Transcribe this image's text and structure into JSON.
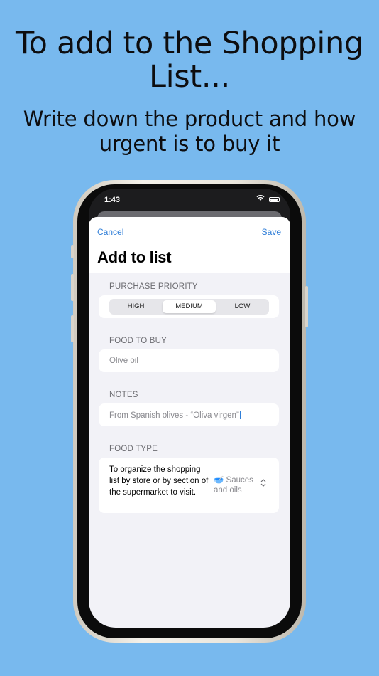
{
  "headline": {
    "title": "To add to the Shopping List...",
    "subtitle": "Write down the product and how urgent is to buy it"
  },
  "status_bar": {
    "time": "1:43"
  },
  "sheet": {
    "cancel_label": "Cancel",
    "save_label": "Save",
    "title": "Add to list",
    "priority": {
      "label": "PURCHASE PRIORITY",
      "options": [
        "HIGH",
        "MEDIUM",
        "LOW"
      ],
      "selected": "MEDIUM"
    },
    "food": {
      "label": "FOOD TO BUY",
      "value": "Olive oil"
    },
    "notes": {
      "label": "NOTES",
      "value": "From Spanish olives - “Oliva virgen”"
    },
    "food_type": {
      "label": "FOOD TYPE",
      "description": "To organize the shopping list by store or by section of the supermarket to visit.",
      "selected_emoji": "🥣",
      "selected_value": "Sauces and oils"
    }
  },
  "colors": {
    "background": "#78b9ee",
    "accent": "#2f7ed8"
  }
}
